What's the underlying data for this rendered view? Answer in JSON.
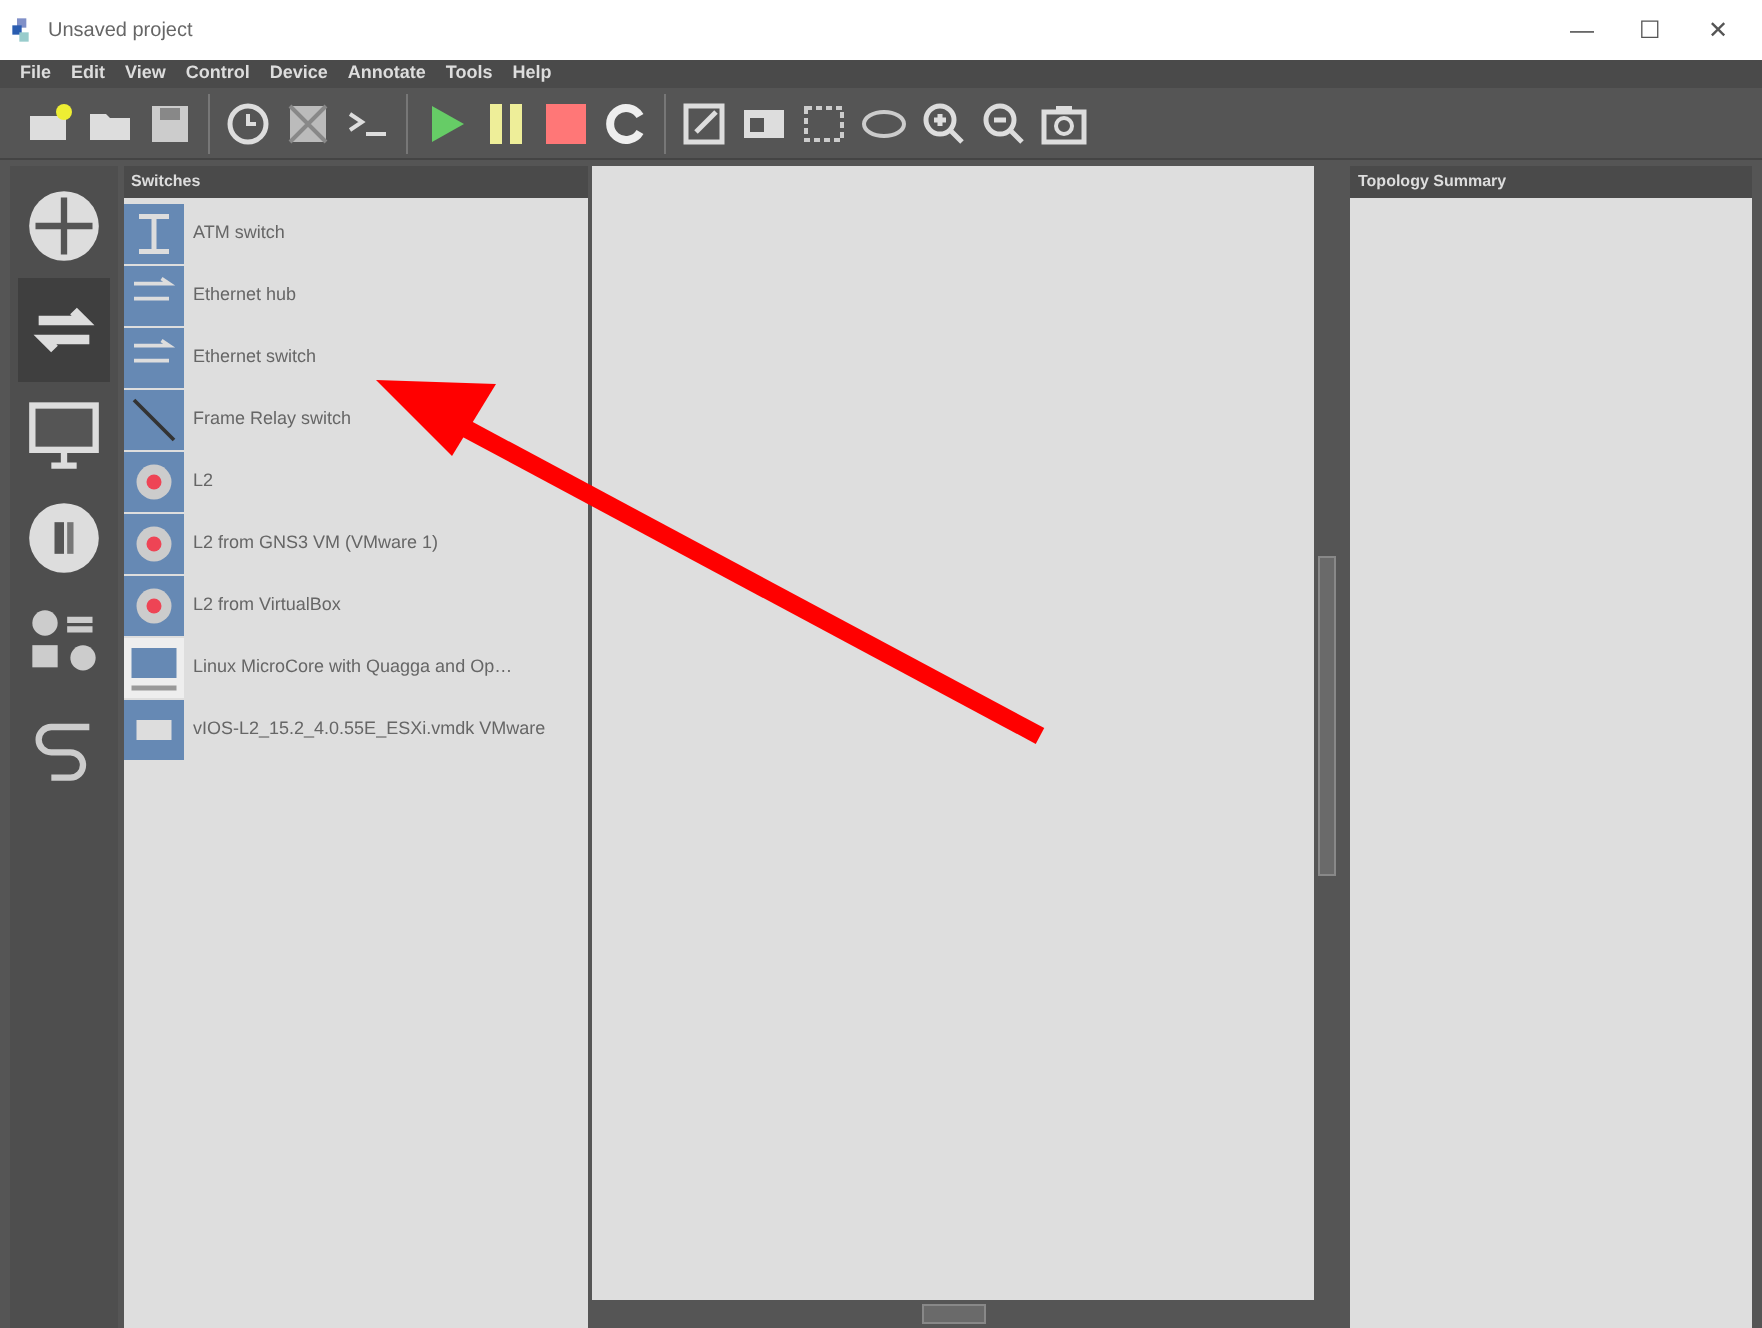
{
  "window": {
    "title": "Unsaved project",
    "controls": [
      "—",
      "☐",
      "✕"
    ]
  },
  "menu": [
    "File",
    "Edit",
    "View",
    "Control",
    "Device",
    "Annotate",
    "Tools",
    "Help"
  ],
  "toolbar": [
    {
      "kind": "new"
    },
    {
      "kind": "open"
    },
    {
      "kind": "save"
    },
    {
      "kind": "separator"
    },
    {
      "kind": "clock"
    },
    {
      "kind": "grid"
    },
    {
      "kind": "console"
    },
    {
      "kind": "separator"
    },
    {
      "kind": "start"
    },
    {
      "kind": "pause"
    },
    {
      "kind": "stop"
    },
    {
      "kind": "reload"
    },
    {
      "kind": "separator"
    },
    {
      "kind": "note"
    },
    {
      "kind": "image"
    },
    {
      "kind": "rect"
    },
    {
      "kind": "ellipse"
    },
    {
      "kind": "zoomin"
    },
    {
      "kind": "zoomout"
    },
    {
      "kind": "camera"
    }
  ],
  "device_types": [
    {
      "kind": "router",
      "selected": false
    },
    {
      "kind": "switch",
      "selected": true
    },
    {
      "kind": "monitor",
      "selected": false
    },
    {
      "kind": "security",
      "selected": false
    },
    {
      "kind": "all",
      "selected": false
    },
    {
      "kind": "cable",
      "selected": false
    }
  ],
  "devices_panel": {
    "title": "Switches",
    "items": [
      {
        "label": "ATM switch",
        "kind": "atm"
      },
      {
        "label": "Ethernet hub",
        "kind": "hub"
      },
      {
        "label": "Ethernet switch",
        "kind": "hub"
      },
      {
        "label": "Frame Relay switch",
        "kind": "line"
      },
      {
        "label": "L2",
        "kind": "l2"
      },
      {
        "label": "L2 from GNS3 VM (VMware 1)",
        "kind": "l2"
      },
      {
        "label": "L2 from VirtualBox",
        "kind": "l2"
      },
      {
        "label": "Linux MicroCore with Quagga and Op…",
        "kind": "linux"
      },
      {
        "label": "vIOS-L2_15.2_4.0.55E_ESXi.vmdk VMware",
        "kind": "vios"
      }
    ]
  },
  "topology_summary": {
    "title": "Topology Summary"
  }
}
